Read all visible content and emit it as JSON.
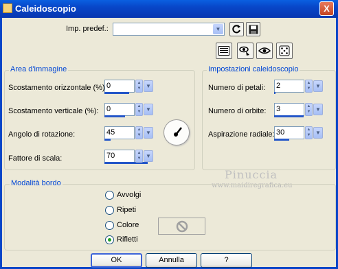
{
  "window": {
    "title": "Caleidoscopio",
    "close_label": "X",
    "accent_color": "#0846c8"
  },
  "preset": {
    "label": "Imp. predef.:",
    "value": "",
    "icons": [
      "reset-icon",
      "save-preset-icon"
    ]
  },
  "toolbar_icons": [
    "layout-icon",
    "eye-hand-icon",
    "eye-icon",
    "dice-icon"
  ],
  "area": {
    "title": "Area d'immagine",
    "fields": [
      {
        "label": "Scostamento orizzontale (%):",
        "value": "0",
        "fill": 0.5
      },
      {
        "label": "Scostamento verticale (%):",
        "value": "0",
        "fill": 0.5
      },
      {
        "label": "Angolo di rotazione:",
        "value": "45",
        "fill": 0.12
      },
      {
        "label": "Fattore di scala:",
        "value": "70",
        "fill": 1.0
      }
    ]
  },
  "kaleido": {
    "title": "Impostazioni caleidoscopio",
    "fields": [
      {
        "label": "Numero di petali:",
        "value": "2",
        "fill": 0.05
      },
      {
        "label": "Numero di orbite:",
        "value": "3",
        "fill": 0.98
      },
      {
        "label": "Aspirazione radiale:",
        "value": "30",
        "fill": 0.5
      }
    ]
  },
  "edge": {
    "title": "Modalità bordo",
    "options": [
      {
        "label": "Avvolgi",
        "selected": false
      },
      {
        "label": "Ripeti",
        "selected": false
      },
      {
        "label": "Colore",
        "selected": false
      },
      {
        "label": "Rifletti",
        "selected": true
      }
    ]
  },
  "watermark": {
    "line1": "Pinuccia",
    "line2": "www.maidiregrafica.eu"
  },
  "buttons": {
    "ok": "OK",
    "cancel": "Annulla",
    "help": "?"
  }
}
